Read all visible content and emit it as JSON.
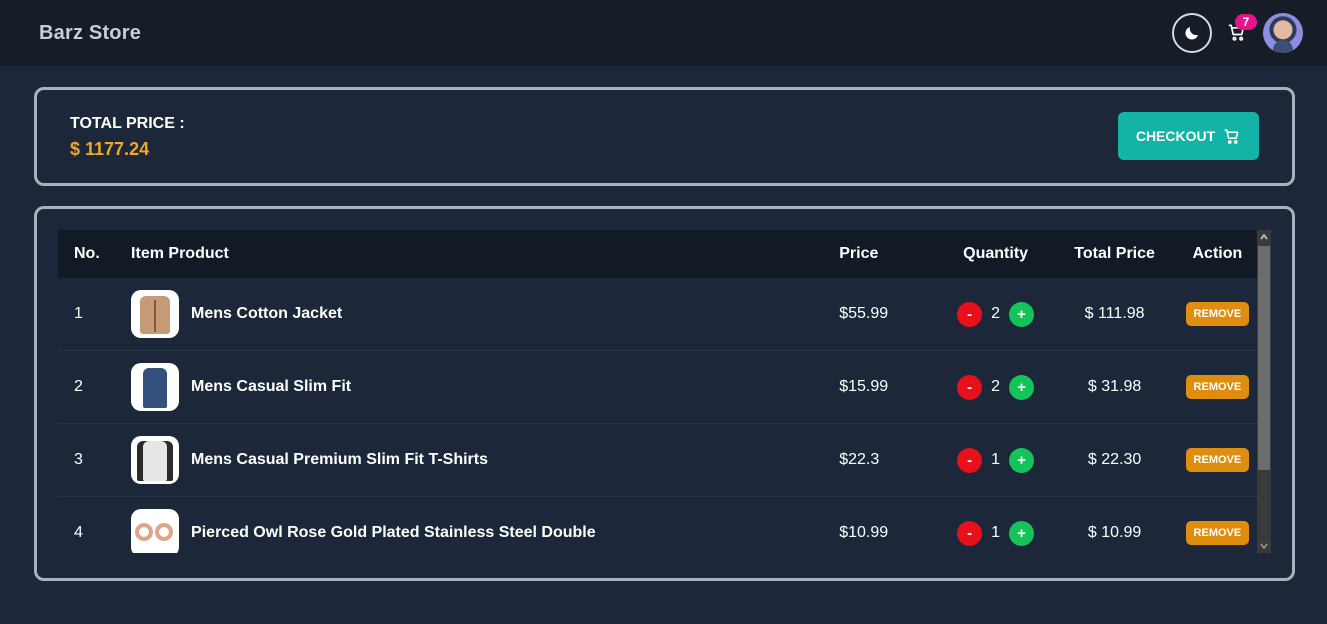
{
  "navbar": {
    "brand": "Barz Store",
    "theme_toggle_icon": "moon-icon",
    "cart_icon": "cart-icon",
    "cart_count": "7",
    "avatar": "user-avatar"
  },
  "summary": {
    "total_label": "TOTAL PRICE :",
    "total_value": "$ 1177.24",
    "checkout_label": "CHECKOUT",
    "checkout_icon": "cart-icon"
  },
  "table": {
    "headers": {
      "no": "No.",
      "item": "Item Product",
      "price": "Price",
      "quantity": "Quantity",
      "total": "Total Price",
      "action": "Action"
    },
    "rows": [
      {
        "no": "1",
        "name": "Mens Cotton Jacket",
        "price": "$55.99",
        "qty": "2",
        "total": "$ 111.98",
        "remove": "REMOVE",
        "thumb": "jacket"
      },
      {
        "no": "2",
        "name": "Mens Casual Slim Fit",
        "price": "$15.99",
        "qty": "2",
        "total": "$ 31.98",
        "remove": "REMOVE",
        "thumb": "blue-shirt"
      },
      {
        "no": "3",
        "name": "Mens Casual Premium Slim Fit T-Shirts",
        "price": "$22.3",
        "qty": "1",
        "total": "$ 22.30",
        "remove": "REMOVE",
        "thumb": "white-shirt"
      },
      {
        "no": "4",
        "name": "Pierced Owl Rose Gold Plated Stainless Steel Double",
        "price": "$10.99",
        "qty": "1",
        "total": "$ 10.99",
        "remove": "REMOVE",
        "thumb": "rings"
      }
    ],
    "minus_label": "-",
    "plus_label": "+"
  },
  "colors": {
    "background": "#1c2839",
    "navbar": "#161d27",
    "accent_total": "#f0a726",
    "checkout": "#13b3a8",
    "remove": "#df8d0e",
    "minus": "#e8101a",
    "plus": "#14c35a",
    "badge": "#e6148b"
  }
}
